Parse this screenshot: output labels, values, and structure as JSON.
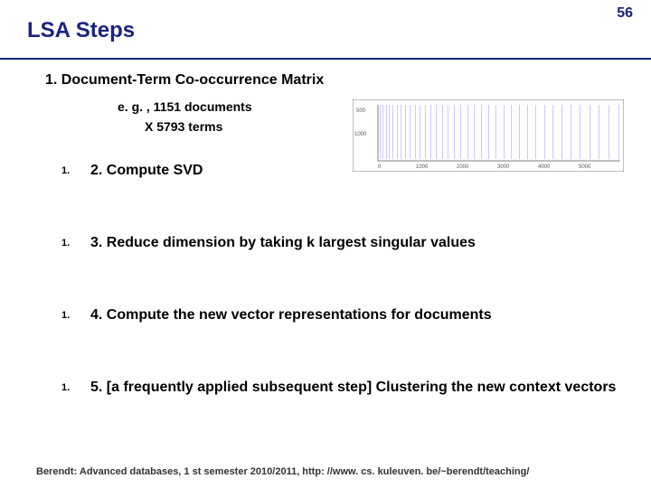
{
  "page_number": "56",
  "title": "LSA Steps",
  "step1": "1. Document-Term  Co-occurrence Matrix",
  "step1_sub_a": "e. g. , 1151 documents",
  "step1_sub_b": "X 5793 terms",
  "marker": "1.",
  "steps": [
    "2. Compute SVD",
    "3. Reduce dimension by taking k largest singular values",
    "4. Compute the new vector representations for documents",
    "5. [a frequently applied subsequent step] Clustering the new context vectors"
  ],
  "footer": "Berendt: Advanced databases, 1 st semester 2010/2011, http: //www. cs. kuleuven. be/~berendt/teaching/",
  "chart_data": {
    "type": "heatmap",
    "title": "",
    "xlabel": "",
    "ylabel": "",
    "xlim": [
      0,
      5793
    ],
    "ylim": [
      0,
      1151
    ],
    "x_ticks": [
      0,
      1000,
      2000,
      3000,
      4000,
      5000
    ],
    "y_ticks": [
      500,
      1000
    ],
    "note": "Sparse document-term co-occurrence matrix visualisation (spy plot). Individual nonzero cell values not readable at this resolution."
  }
}
